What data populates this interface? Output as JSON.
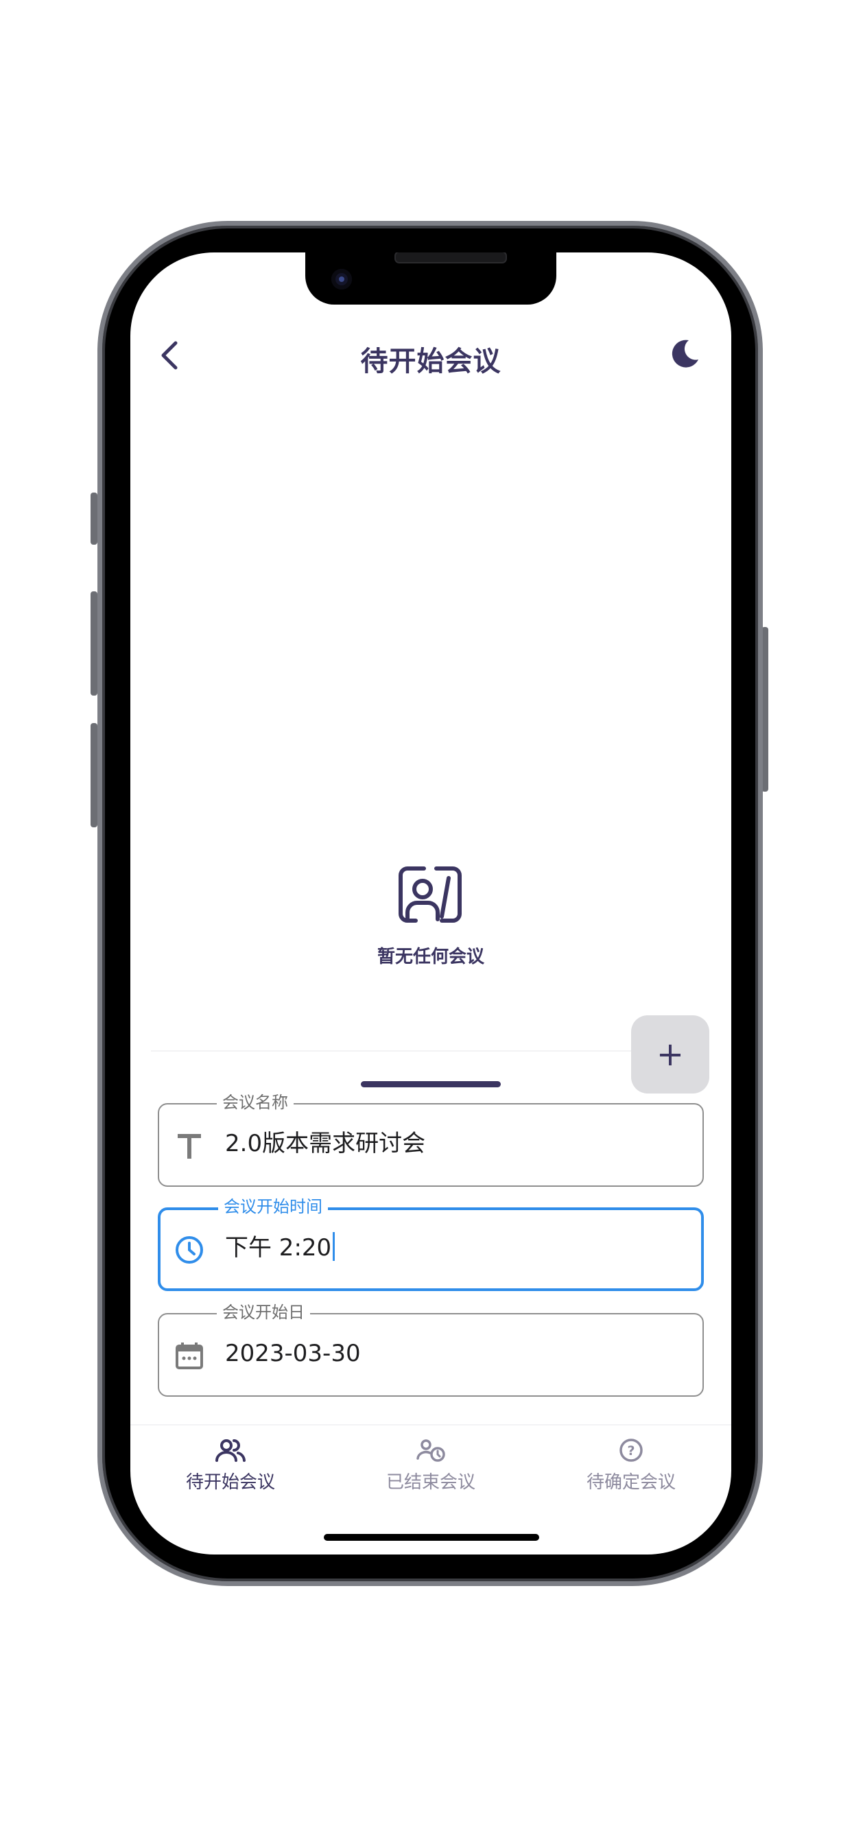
{
  "header": {
    "title": "待开始会议"
  },
  "empty_state": {
    "message": "暂无任何会议"
  },
  "fab": {
    "label": "+"
  },
  "form": {
    "name_field": {
      "label": "会议名称",
      "value": "2.0版本需求研讨会"
    },
    "time_field": {
      "label": "会议开始时间",
      "value": "下午 2:20"
    },
    "date_field": {
      "label": "会议开始日",
      "value": "2023-03-30"
    }
  },
  "tabs": [
    {
      "label": "待开始会议",
      "icon": "people-icon",
      "active": true
    },
    {
      "label": "已结束会议",
      "icon": "people-clock-icon",
      "active": false
    },
    {
      "label": "待确定会议",
      "icon": "question-icon",
      "active": false
    }
  ],
  "colors": {
    "primary": "#3b3561",
    "accent": "#2f8dea",
    "inactive": "#8d8a9e"
  }
}
